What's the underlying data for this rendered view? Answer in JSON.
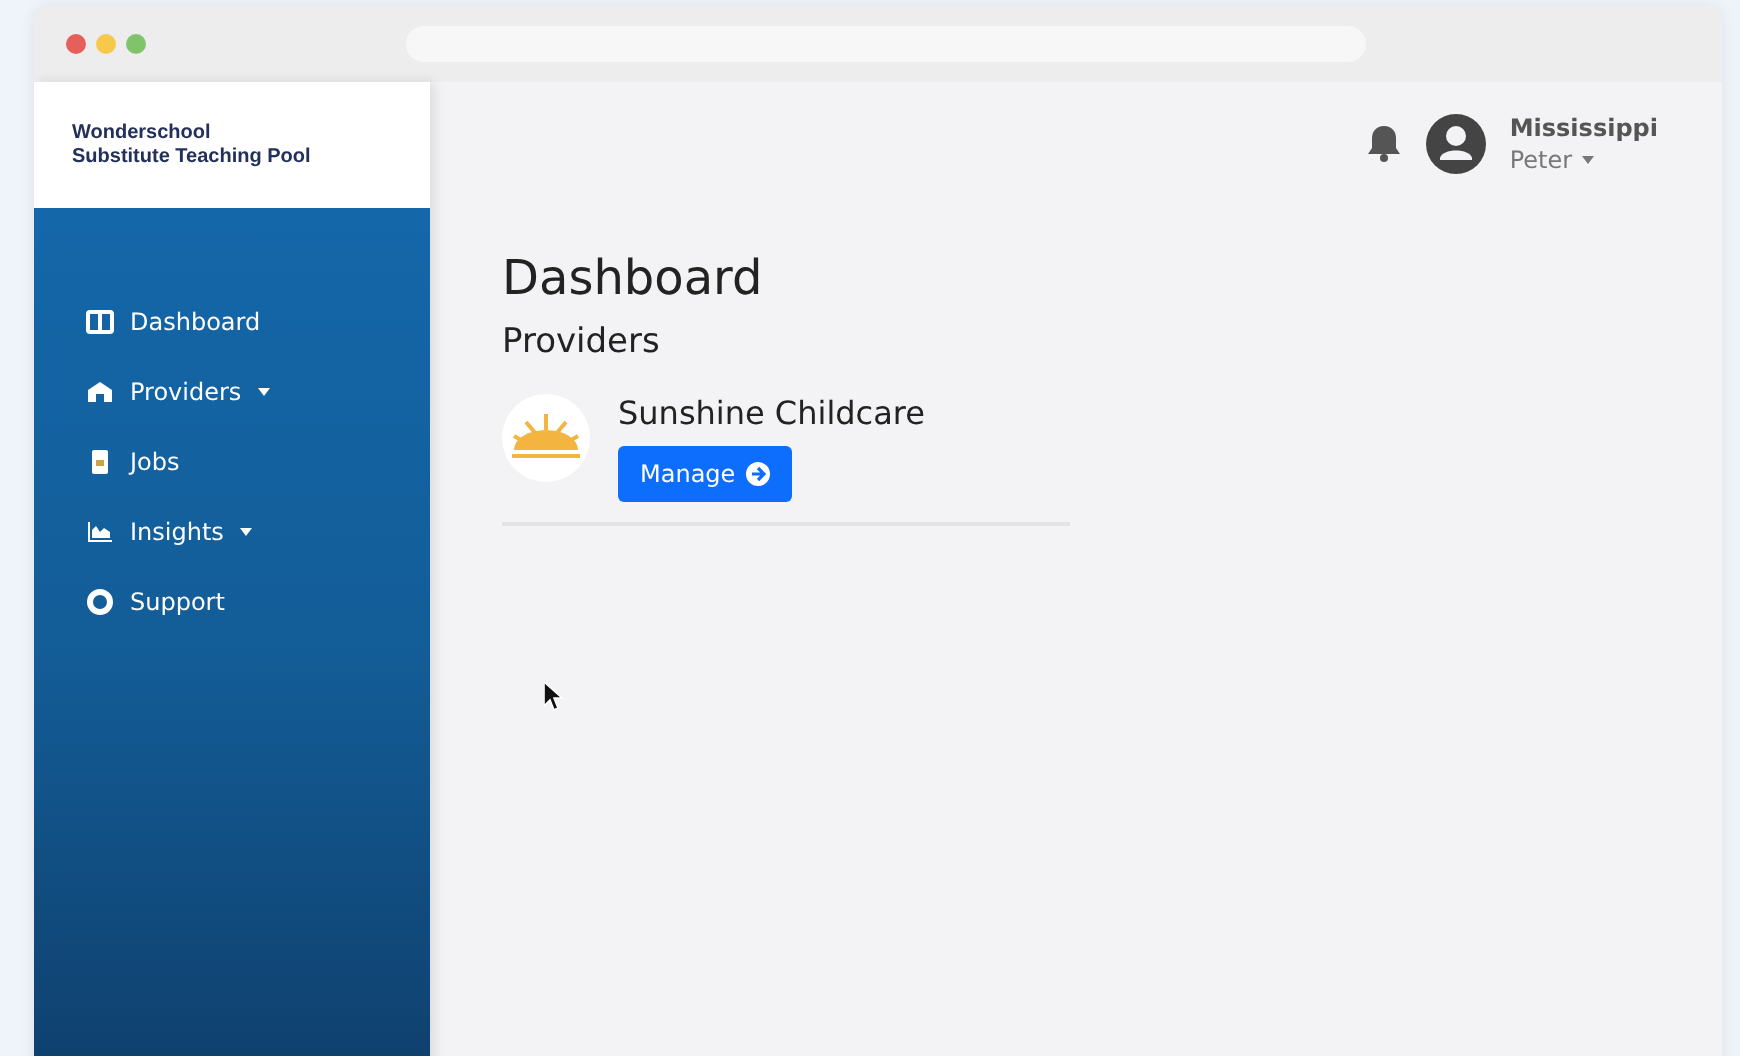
{
  "brand": {
    "line1": "Wonderschool",
    "line2": "Substitute Teaching Pool"
  },
  "nav": [
    {
      "kind": "dashboard",
      "label": "Dashboard",
      "dropdown": false
    },
    {
      "kind": "providers",
      "label": "Providers",
      "dropdown": true
    },
    {
      "kind": "jobs",
      "label": "Jobs",
      "dropdown": false
    },
    {
      "kind": "insights",
      "label": "Insights",
      "dropdown": true
    },
    {
      "kind": "support",
      "label": "Support",
      "dropdown": false
    }
  ],
  "user": {
    "region": "Mississippi",
    "name": "Peter"
  },
  "page": {
    "title": "Dashboard",
    "section": "Providers"
  },
  "providers": [
    {
      "name": "Sunshine Childcare",
      "action": "Manage"
    }
  ]
}
